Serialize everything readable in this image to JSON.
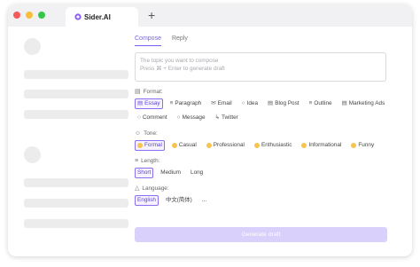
{
  "browser": {
    "tab_title": "Sider.AI",
    "new_tab_symbol": "+"
  },
  "colors": {
    "accent": "#7b5cf0",
    "button_disabled": "#d9d0fb",
    "skeleton": "#ececec"
  },
  "panel": {
    "mode_tabs": [
      {
        "label": "Compose",
        "active": true
      },
      {
        "label": "Reply",
        "active": false
      }
    ],
    "topic_placeholder_line1": "The topic you want to compose",
    "topic_placeholder_line2": "Press ⌘ + Enter to generate draft",
    "format": {
      "label": "Format:",
      "options": [
        {
          "label": "Essay",
          "icon": "essay-icon",
          "selected": true
        },
        {
          "label": "Paragraph",
          "icon": "paragraph-icon",
          "selected": false
        },
        {
          "label": "Email",
          "icon": "email-icon",
          "selected": false
        },
        {
          "label": "Idea",
          "icon": "idea-icon",
          "selected": false
        },
        {
          "label": "Blog Post",
          "icon": "blog-post-icon",
          "selected": false
        },
        {
          "label": "Outline",
          "icon": "outline-icon",
          "selected": false
        },
        {
          "label": "Marketing Ads",
          "icon": "marketing-ads-icon",
          "selected": false
        },
        {
          "label": "Comment",
          "icon": "comment-icon",
          "selected": false
        },
        {
          "label": "Message",
          "icon": "message-icon",
          "selected": false
        },
        {
          "label": "Twitter",
          "icon": "twitter-icon",
          "selected": false
        }
      ]
    },
    "tone": {
      "label": "Tone:",
      "options": [
        {
          "label": "Formal",
          "selected": true
        },
        {
          "label": "Casual",
          "selected": false
        },
        {
          "label": "Professional",
          "selected": false
        },
        {
          "label": "Enthusiastic",
          "selected": false
        },
        {
          "label": "Informational",
          "selected": false
        },
        {
          "label": "Funny",
          "selected": false
        }
      ]
    },
    "length": {
      "label": "Length:",
      "options": [
        {
          "label": "Short",
          "selected": true
        },
        {
          "label": "Medium",
          "selected": false
        },
        {
          "label": "Long",
          "selected": false
        }
      ]
    },
    "language": {
      "label": "Language:",
      "options": [
        {
          "label": "English",
          "selected": true
        },
        {
          "label": "中文(简体)",
          "selected": false
        },
        {
          "label": "...",
          "selected": false
        }
      ]
    },
    "generate_label": "Generate draft"
  }
}
